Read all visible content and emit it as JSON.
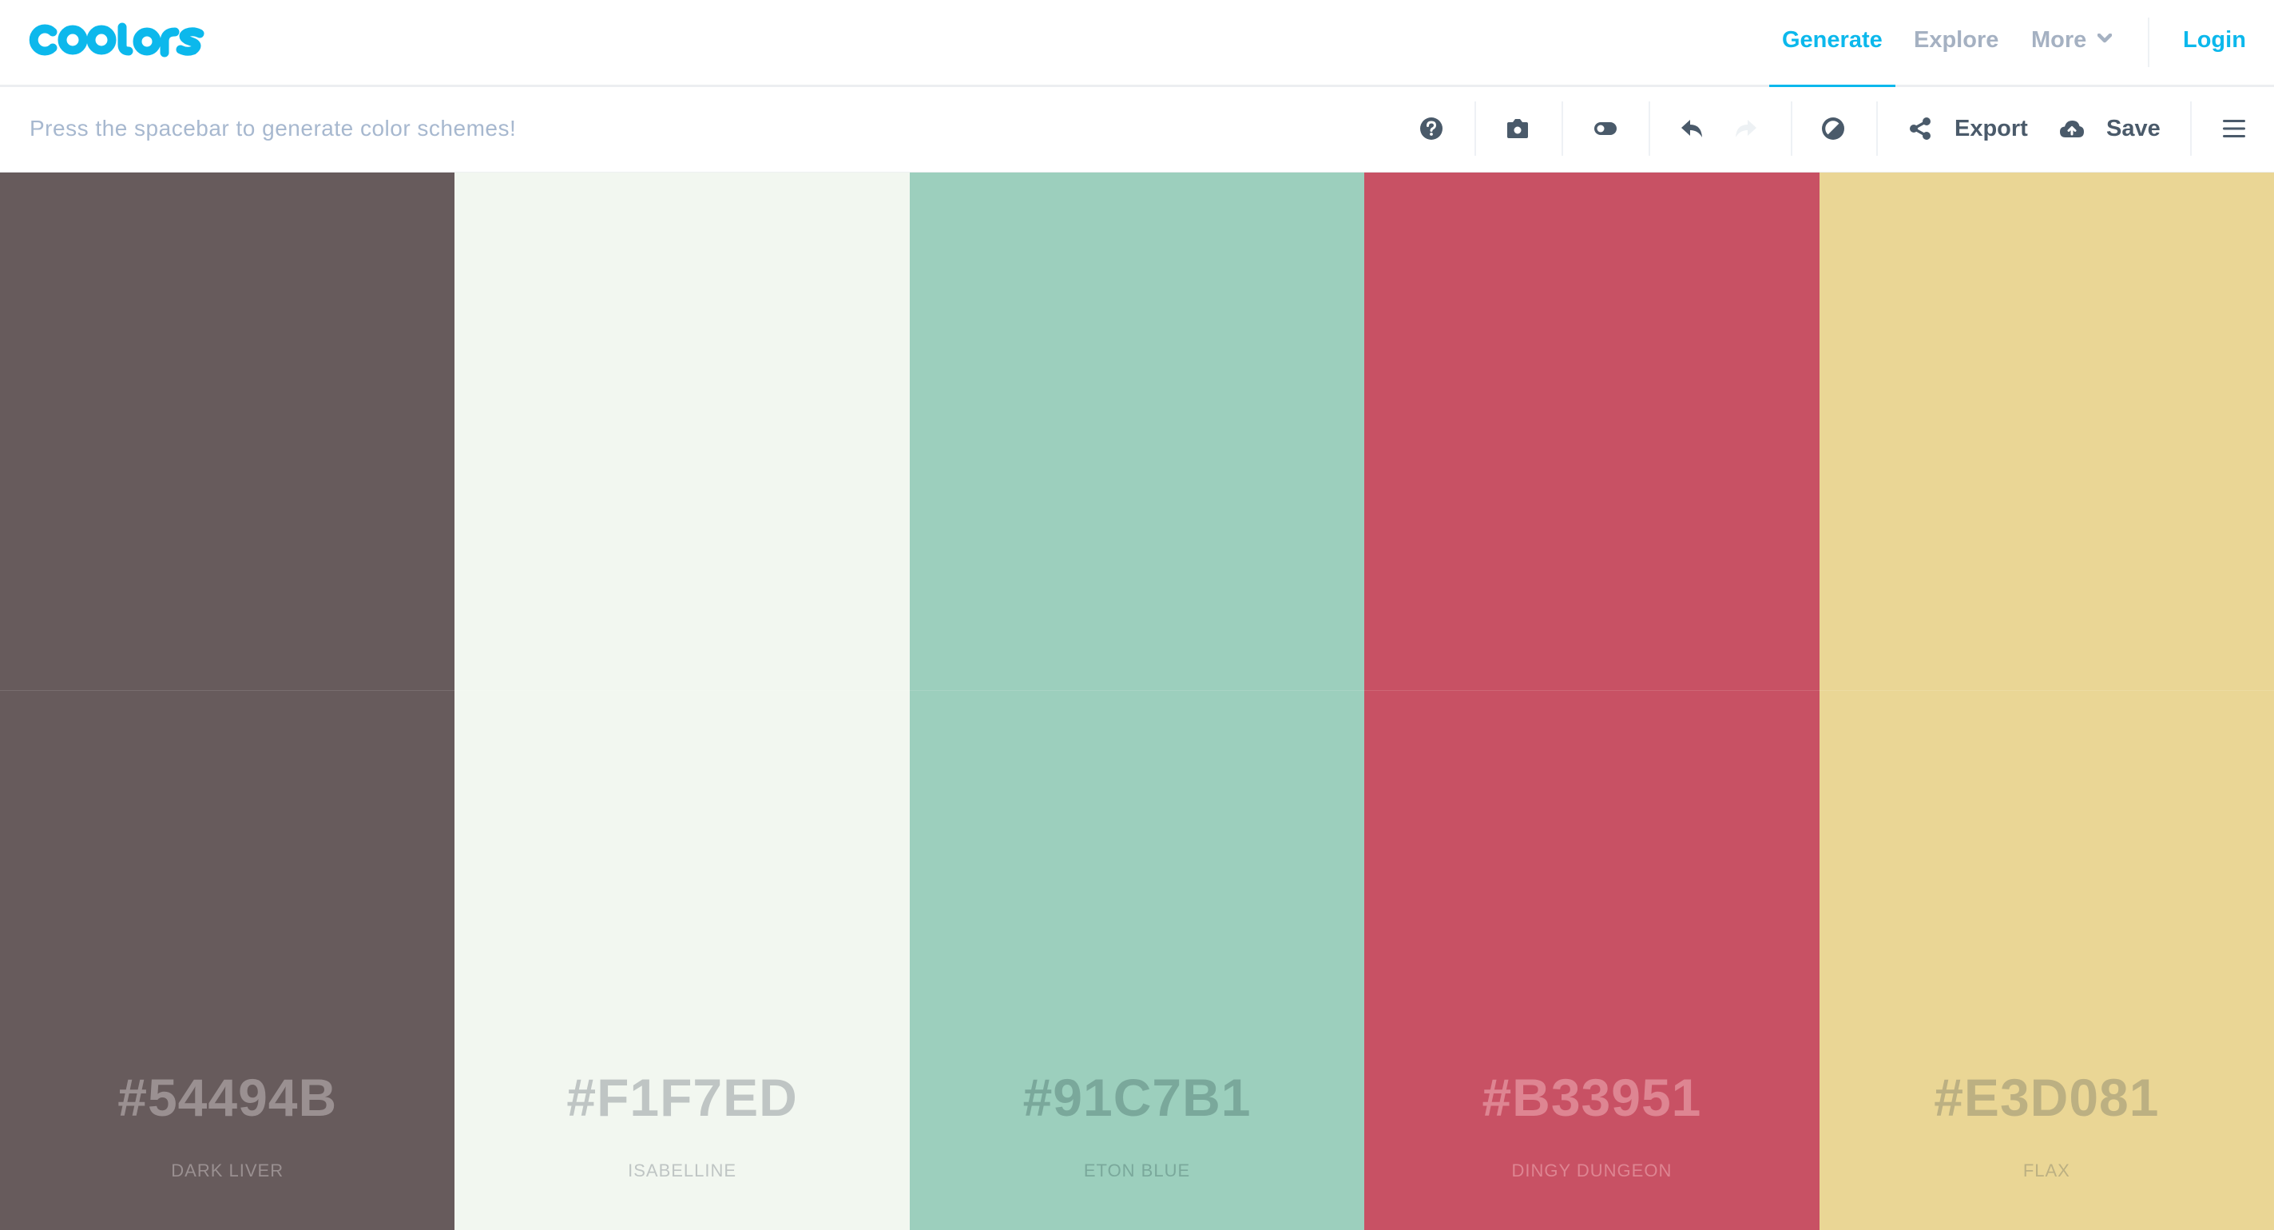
{
  "app": {
    "logo_text": "coolors",
    "brand_color": "#0cb8ec"
  },
  "nav": {
    "items": [
      {
        "label": "Generate",
        "active": true
      },
      {
        "label": "Explore",
        "active": false
      },
      {
        "label": "More",
        "active": false,
        "icon": "chevron-down-icon"
      }
    ],
    "login_label": "Login"
  },
  "toolbar": {
    "hint": "Press the spacebar to generate color schemes!",
    "icons": [
      "help-icon",
      "camera-icon",
      "toggle-icon",
      "undo-icon",
      "redo-icon",
      "contrast-icon"
    ],
    "export_label": "Export",
    "save_label": "Save",
    "menu_icon": "hamburger-menu-icon"
  },
  "palette": {
    "swatches": [
      {
        "hex": "#54494B",
        "name": "DARK LIVER",
        "fill": "#675b5c",
        "text_color": "#9a9091"
      },
      {
        "hex": "#F1F7ED",
        "name": "ISABELLINE",
        "fill": "#f2f7f0",
        "text_color": "#bfc5c4"
      },
      {
        "hex": "#91C7B1",
        "name": "ETON BLUE",
        "fill": "#9ccfbd",
        "text_color": "#7aa89b"
      },
      {
        "hex": "#B33951",
        "name": "DINGY DUNGEON",
        "fill": "#c85164",
        "text_color": "#de8592"
      },
      {
        "hex": "#E3D081",
        "name": "FLAX",
        "fill": "#ead695",
        "text_color": "#bcb082"
      }
    ]
  }
}
